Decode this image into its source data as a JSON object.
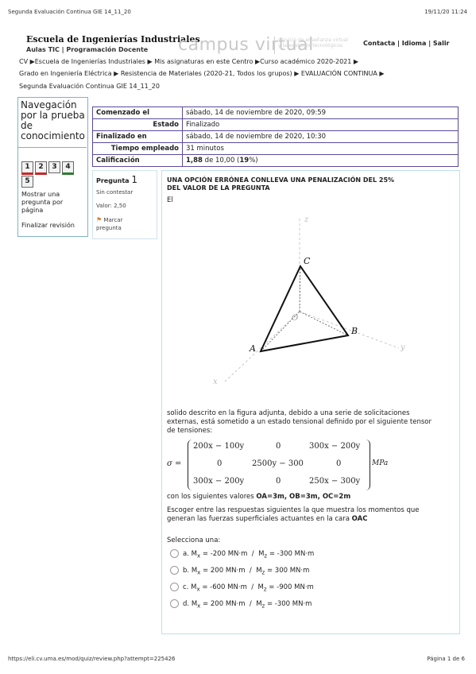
{
  "print_header": {
    "title": "Segunda Evaluación Continua GIE 14_11_20",
    "datetime": "19/11/20 11:24"
  },
  "site": {
    "title": "Escuela de Ingenierías Industriales",
    "subtitle": "Aulas TIC | Programación Docente",
    "brand": "campus virtual",
    "brand_tag_1": "servicio de enseñanza virtual",
    "brand_tag_2": "y laboratorios tecnológicos",
    "links": "Contacta | Idioma | Salir"
  },
  "breadcrumb": {
    "line1": "CV ▶Escuela de Ingenierías Industriales ▶ Mis asignaturas en este Centro ▶Curso académico 2020-2021 ▶",
    "line2": "Grado en Ingeniería Eléctrica ▶ Resistencia de Materiales (2020-21, Todos los grupos) ▶ EVALUACIÓN CONTINUA ▶",
    "line3": "Segunda Evaluación Continua GIE 14_11_20"
  },
  "nav": {
    "title_1": "Navegación",
    "title_2": "por la prueba",
    "title_3": "de",
    "title_4": "conocimiento",
    "buttons": [
      "1",
      "2",
      "3",
      "4",
      "5"
    ],
    "show_one_1": "Mostrar una",
    "show_one_2": "pregunta por",
    "show_one_3": "página",
    "finish": "Finalizar revisión"
  },
  "summary": {
    "rows": [
      {
        "label": "Comenzado el",
        "value": "sábado, 14 de noviembre de 2020, 09:59"
      },
      {
        "label": "Estado",
        "value": "Finalizado"
      },
      {
        "label": "Finalizado en",
        "value": "sábado, 14 de noviembre de 2020, 10:30"
      },
      {
        "label": "Tiempo empleado",
        "value": "31 minutos"
      },
      {
        "label": "Calificación",
        "value_bold": "1,88",
        "value_mid": " de 10,00 (",
        "value_pct": "19",
        "value_end": "%)"
      }
    ]
  },
  "question_info": {
    "label": "Pregunta",
    "number": "1",
    "status": "Sin contestar",
    "value": "Valor: 2,50",
    "flag_1": "Marcar",
    "flag_2": "pregunta"
  },
  "question": {
    "heading_1": "UNA OPCIÓN ERRÓNEA CONLLEVA UNA PENALIZACIÓN DEL 25%",
    "heading_2": "DEL VALOR DE LA PREGUNTA",
    "intro": "El",
    "figure_labels": {
      "z": "z",
      "y": "y",
      "x": "x",
      "o": "O",
      "a": "A",
      "b": "B",
      "c": "C"
    },
    "body_1": "solido descrito en la figura adjunta, debido a una serie de solicitaciones",
    "body_2": "externas, está sometido a un estado tensional definido por el siguiente tensor",
    "body_3": "de tensiones:",
    "sigma": "σ =",
    "matrix": [
      [
        "200x − 100y",
        "0",
        "300x − 200y"
      ],
      [
        "0",
        "2500y − 300",
        "0"
      ],
      [
        "300x − 200y",
        "0",
        "250x − 300y"
      ]
    ],
    "units": "MPa",
    "values_prefix": "con los siguientes valores ",
    "values_bold": "OA=3m, OB=3m, OC=2m",
    "prompt_1": "Escoger entre las respuestas siguientes la que muestra los momentos que",
    "prompt_2_prefix": "generan las fuerzas superficiales actuantes en la cara ",
    "prompt_2_bold": "OAC",
    "select_one": "Selecciona una:",
    "options": [
      {
        "letter": "a.",
        "mx": "-200",
        "mz": "-300"
      },
      {
        "letter": "b.",
        "mx": "200",
        "mz": "300"
      },
      {
        "letter": "c.",
        "mx": "-600",
        "mz": "-900"
      },
      {
        "letter": "d.",
        "mx": "200",
        "mz": "-300"
      }
    ],
    "unit": "MN·m",
    "mx_label": "M",
    "mx_sub": "x",
    "mz_sub": "z"
  },
  "print_footer": {
    "url": "https://eli.cv.uma.es/mod/quiz/review.php?attempt=225426",
    "page": "Página 1 de 6"
  }
}
